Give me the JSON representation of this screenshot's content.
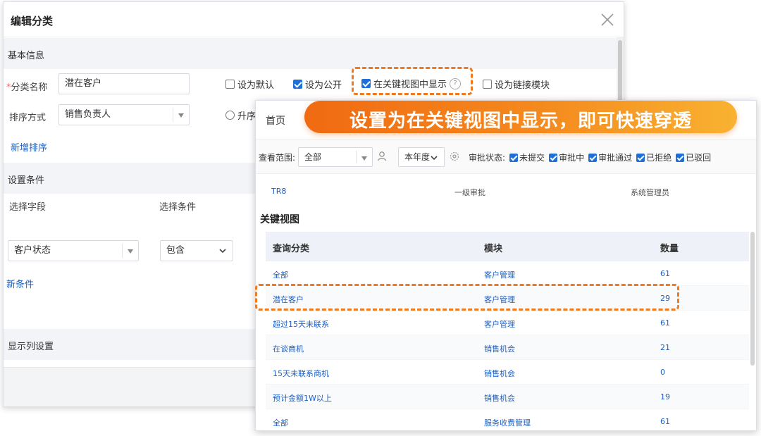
{
  "dialog": {
    "title": "编辑分类",
    "basic_section": "基本信息",
    "category_name_label": "分类名称",
    "category_name_value": "潜在客户",
    "set_default": "设为默认",
    "set_public": "设为公开",
    "show_in_key_view": "在关键视图中显示",
    "help": "?",
    "set_link_module": "设为链接模块",
    "sort_label": "排序方式",
    "sort_value": "销售负责人",
    "sort_asc": "升序",
    "add_sort": "新增排序",
    "condition_section": "设置条件",
    "select_field": "选择字段",
    "select_condition": "选择条件",
    "field_value": "客户状态",
    "condition_value": "包含",
    "new_condition": "新条件",
    "display_columns": "显示列设置",
    "checkboxes": {
      "set_default": false,
      "set_public": true,
      "show_in_key_view": true,
      "set_link_module": false
    }
  },
  "banner": {
    "text": "设置为在关键视图中显示，即可快速穿透"
  },
  "home": {
    "title": "首页",
    "scope_label": "查看范围:",
    "scope_value": "全部",
    "year_value": "本年度",
    "approval_label": "审批状态:",
    "approval_items": [
      "未提交",
      "审批中",
      "审批通过",
      "已拒绝",
      "已驳回"
    ],
    "tr8_row": [
      "TR8",
      "一级审批",
      "系统管理员"
    ],
    "key_view_title": "关键视图",
    "columns": [
      "查询分类",
      "模块",
      "数量"
    ],
    "rows": [
      {
        "category": "全部",
        "module": "客户管理",
        "count": "61"
      },
      {
        "category": "潜在客户",
        "module": "客户管理",
        "count": "29"
      },
      {
        "category": "超过15天未联系",
        "module": "客户管理",
        "count": "61"
      },
      {
        "category": "在谈商机",
        "module": "销售机会",
        "count": "21"
      },
      {
        "category": "15天未联系商机",
        "module": "销售机会",
        "count": "0"
      },
      {
        "category": "预计金额1W以上",
        "module": "销售机会",
        "count": "19"
      },
      {
        "category": "全部",
        "module": "服务收费管理",
        "count": "61"
      }
    ]
  },
  "colors": {
    "accent": "#1f6fd6",
    "highlight": "#f07a1d",
    "link": "#1f5fbf"
  }
}
